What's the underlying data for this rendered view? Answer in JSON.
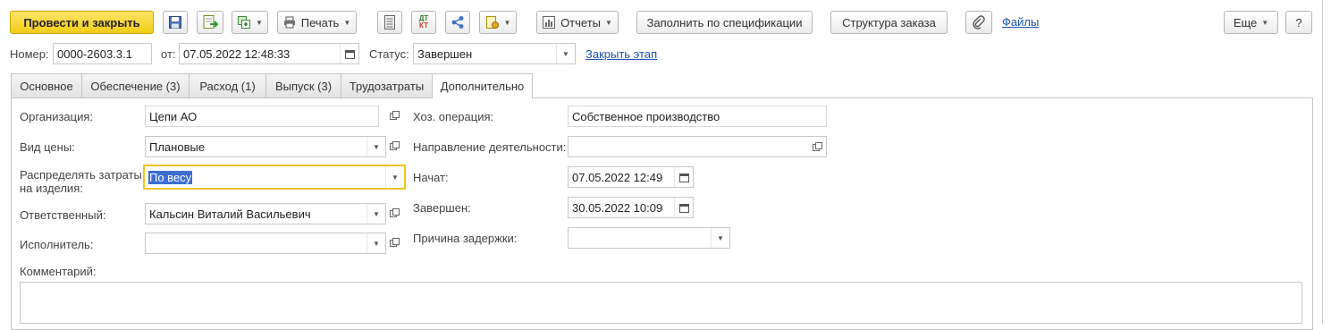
{
  "toolbar": {
    "post_close": "Провести и закрыть",
    "print": "Печать",
    "reports": "Отчеты",
    "fill_spec": "Заполнить по спецификации",
    "order_structure": "Структура заказа",
    "files": "Файлы",
    "more": "Еще",
    "help": "?",
    "dt_kt_top": "ДТ",
    "dt_kt_bottom": "КТ"
  },
  "header": {
    "number_label": "Номер:",
    "number_value": "0000-2603.3.1",
    "from_label": "от:",
    "date_value": "07.05.2022 12:48:33",
    "status_label": "Статус:",
    "status_value": "Завершен",
    "close_stage": "Закрыть этап"
  },
  "tabs": [
    {
      "label": "Основное"
    },
    {
      "label": "Обеспечение (3)"
    },
    {
      "label": "Расход (1)"
    },
    {
      "label": "Выпуск (3)"
    },
    {
      "label": "Трудозатраты"
    },
    {
      "label": "Дополнительно"
    }
  ],
  "left": {
    "org_label": "Организация:",
    "org_value": "Цепи АО",
    "price_label": "Вид цены:",
    "price_value": "Плановые",
    "distribute_label_1": "Распределять затраты",
    "distribute_label_2": "на изделия:",
    "distribute_value": "По весу",
    "responsible_label": "Ответственный:",
    "responsible_value": "Кальсин Виталий Васильевич",
    "executor_label": "Исполнитель:",
    "executor_value": ""
  },
  "right": {
    "operation_label": "Хоз. операция:",
    "operation_value": "Собственное производство",
    "direction_label": "Направление деятельности:",
    "direction_value": "",
    "started_label": "Начат:",
    "started_value": "07.05.2022 12:49",
    "finished_label": "Завершен:",
    "finished_value": "30.05.2022 10:09",
    "delay_label": "Причина задержки:",
    "delay_value": ""
  },
  "comment": {
    "label": "Комментарий:",
    "value": ""
  },
  "colors": {
    "accent_yellow": "#f2cd13",
    "link_blue": "#1c54b0",
    "focus_border": "#f0c419",
    "selection": "#3d6fd1"
  }
}
